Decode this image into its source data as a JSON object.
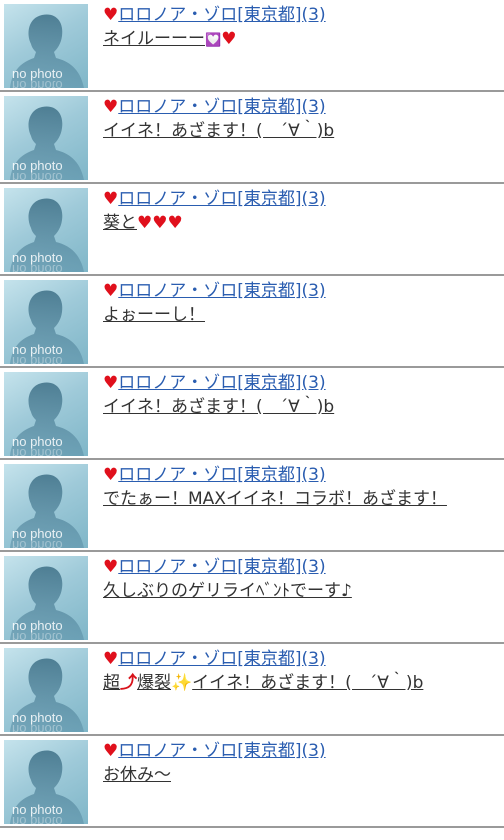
{
  "posts": [
    {
      "user": "ロロノア・ゾロ[東京都](3)",
      "avatar_label": "no photo",
      "message": [
        "ネイルーーー",
        {
          "e": "sparkle-heart",
          "c": "purple",
          "t": "💟"
        },
        {
          "e": "heart",
          "c": "red",
          "t": "♥"
        }
      ]
    },
    {
      "user": "ロロノア・ゾロ[東京都](3)",
      "avatar_label": "no photo",
      "message": [
        "イイネ！あざます！(　´∀｀)b"
      ]
    },
    {
      "user": "ロロノア・ゾロ[東京都](3)",
      "avatar_label": "no photo",
      "message": [
        "葵と",
        {
          "e": "heart",
          "c": "red",
          "t": "♥"
        },
        {
          "e": "heart",
          "c": "red",
          "t": "♥"
        },
        {
          "e": "heart",
          "c": "red",
          "t": "♥"
        }
      ]
    },
    {
      "user": "ロロノア・ゾロ[東京都](3)",
      "avatar_label": "no photo",
      "message": [
        "よぉーーし！"
      ]
    },
    {
      "user": "ロロノア・ゾロ[東京都](3)",
      "avatar_label": "no photo",
      "message": [
        "イイネ！あざます！(　´∀｀)b"
      ]
    },
    {
      "user": "ロロノア・ゾロ[東京都](3)",
      "avatar_label": "no photo",
      "message": [
        "でたぁー！MAXイイネ！コラボ！あざます！"
      ]
    },
    {
      "user": "ロロノア・ゾロ[東京都](3)",
      "avatar_label": "no photo",
      "message": [
        "久しぶりのゲリライﾍﾞﾝﾄでーす♪"
      ]
    },
    {
      "user": "ロロノア・ゾロ[東京都](3)",
      "avatar_label": "no photo",
      "message": [
        "超",
        {
          "e": "arrow-up-icon",
          "c": "arrow",
          "t": "⤴"
        },
        "爆裂",
        {
          "e": "sparkle-icon",
          "c": "orange",
          "t": "✨"
        },
        "イイネ！あざます！(　´∀｀)b"
      ]
    },
    {
      "user": "ロロノア・ゾロ[東京都](3)",
      "avatar_label": "no photo",
      "message": [
        "お休み〜"
      ]
    }
  ],
  "colors": {
    "heart": "#e0101c",
    "link": "#2a5db0",
    "divider": "#9a9a9a",
    "text": "#333333"
  },
  "icons": {
    "prefix": "♥"
  }
}
